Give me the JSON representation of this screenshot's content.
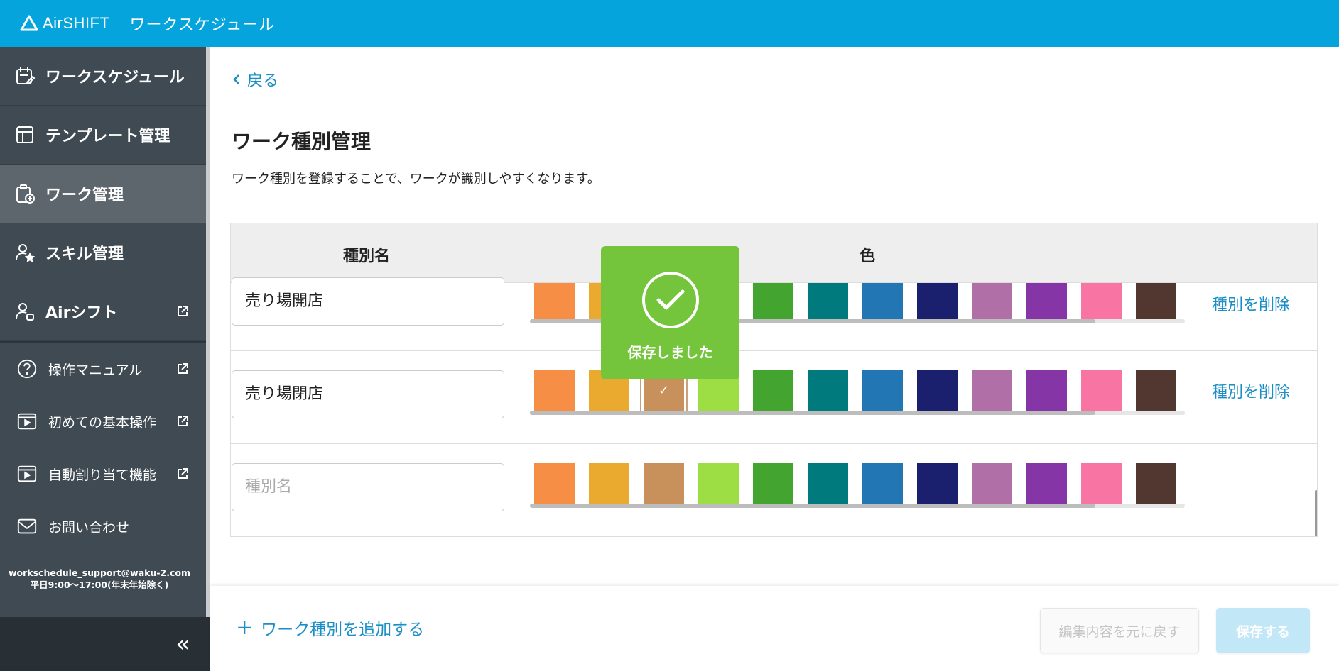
{
  "app": {
    "logo_text": "AirSHIFT",
    "title": "ワークスケジュール"
  },
  "sidebar": {
    "items": [
      {
        "label": "ワークスケジュール",
        "icon": "calendar-edit-icon"
      },
      {
        "label": "テンプレート管理",
        "icon": "template-icon"
      },
      {
        "label": "ワーク管理",
        "icon": "clipboard-add-icon",
        "active": true
      },
      {
        "label": "スキル管理",
        "icon": "person-star-icon"
      },
      {
        "label": "Airシフト",
        "icon": "person-app-icon",
        "external": true
      }
    ],
    "links": [
      {
        "label": "操作マニュアル",
        "icon": "question-circle-icon",
        "external": true
      },
      {
        "label": "初めての基本操作",
        "icon": "video-icon",
        "external": true
      },
      {
        "label": "自動割り当て機能",
        "icon": "video-icon",
        "external": true
      },
      {
        "label": "お問い合わせ",
        "icon": "mail-icon",
        "external": false
      }
    ],
    "support_email": "workschedule_support@waku-2.com",
    "support_hours": "平日9:00〜17:00(年末年始除く)",
    "collapse_icon": "«"
  },
  "main": {
    "back_label": "戻る",
    "page_title": "ワーク種別管理",
    "description": "ワーク種別を登録することで、ワークが識別しやすくなります。",
    "table": {
      "header_name": "種別名",
      "header_color": "色",
      "palette": [
        "#f78e45",
        "#eaa92f",
        "#c8915b",
        "#9dde45",
        "#43a52f",
        "#007a7d",
        "#2276b4",
        "#1a1f6e",
        "#b06fa6",
        "#8535a6",
        "#f874a2",
        "#523630"
      ],
      "rows": [
        {
          "name": "売り場開店",
          "selected_index": -1,
          "delete_label": "種別を削除"
        },
        {
          "name": "売り場閉店",
          "selected_index": 2,
          "delete_label": "種別を削除"
        },
        {
          "name": "",
          "placeholder": "種別名",
          "selected_index": -1,
          "delete_label": ""
        }
      ],
      "selected_check": "✓"
    },
    "toast": {
      "message": "保存しました",
      "color": "#74c43c"
    }
  },
  "footer": {
    "add_label": "ワーク種別を追加する",
    "add_plus": "+",
    "revert_label": "編集内容を元に戻す",
    "save_label": "保存する"
  },
  "colors": {
    "topbar": "#05a4dc",
    "sidebar": "#3f4a52",
    "link": "#1a8ec5"
  }
}
